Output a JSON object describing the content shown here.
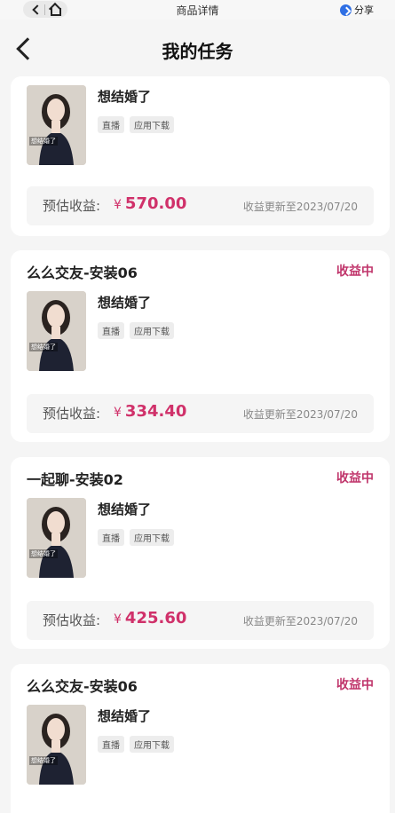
{
  "topbar": {
    "title": "商品详情",
    "share_label": "分享"
  },
  "header": {
    "title": "我的任务"
  },
  "earn_label": "预估收益:",
  "currency": "¥",
  "status_color": "#c0356b",
  "accent": "#d0316a",
  "cards": [
    {
      "name": "",
      "status": "",
      "app_name": "想结婚了",
      "thumb_caption": "想结婚了",
      "tags": [
        "直播",
        "应用下载"
      ],
      "earnings": "570.00",
      "updated": "收益更新至2023/07/20"
    },
    {
      "name": "么么交友-安装06",
      "status": "收益中",
      "app_name": "想结婚了",
      "thumb_caption": "想结婚了",
      "tags": [
        "直播",
        "应用下载"
      ],
      "earnings": "334.40",
      "updated": "收益更新至2023/07/20"
    },
    {
      "name": "一起聊-安装02",
      "status": "收益中",
      "app_name": "想结婚了",
      "thumb_caption": "想结婚了",
      "tags": [
        "直播",
        "应用下载"
      ],
      "earnings": "425.60",
      "updated": "收益更新至2023/07/20"
    },
    {
      "name": "么么交友-安装06",
      "status": "收益中",
      "app_name": "想结婚了",
      "thumb_caption": "想结婚了",
      "tags": [
        "直播",
        "应用下载"
      ],
      "earnings": "",
      "updated": ""
    }
  ]
}
